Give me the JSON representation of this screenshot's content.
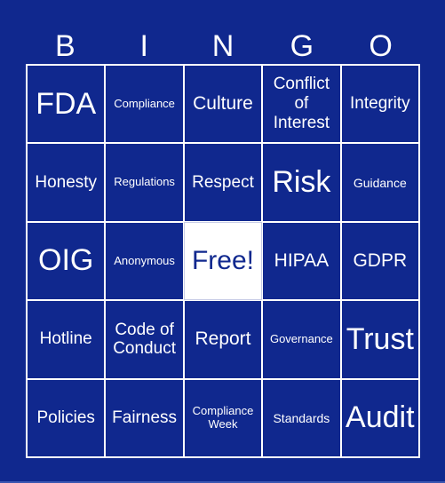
{
  "header": [
    "B",
    "I",
    "N",
    "G",
    "O"
  ],
  "cells": [
    {
      "text": "FDA",
      "size": "s-xl"
    },
    {
      "text": "Compliance",
      "size": "s-xs"
    },
    {
      "text": "Culture",
      "size": "s-m"
    },
    {
      "text": "Conflict of Interest",
      "size": "s-md"
    },
    {
      "text": "Integrity",
      "size": "s-md"
    },
    {
      "text": "Honesty",
      "size": "s-md"
    },
    {
      "text": "Regulations",
      "size": "s-xs"
    },
    {
      "text": "Respect",
      "size": "s-md"
    },
    {
      "text": "Risk",
      "size": "s-xl"
    },
    {
      "text": "Guidance",
      "size": "s-sm"
    },
    {
      "text": "OIG",
      "size": "s-xl"
    },
    {
      "text": "Anonymous",
      "size": "s-xs"
    },
    {
      "text": "Free!",
      "size": "s-l",
      "free": true
    },
    {
      "text": "HIPAA",
      "size": "s-m"
    },
    {
      "text": "GDPR",
      "size": "s-m"
    },
    {
      "text": "Hotline",
      "size": "s-md"
    },
    {
      "text": "Code of Conduct",
      "size": "s-md"
    },
    {
      "text": "Report",
      "size": "s-m"
    },
    {
      "text": "Governance",
      "size": "s-xs"
    },
    {
      "text": "Trust",
      "size": "s-xl"
    },
    {
      "text": "Policies",
      "size": "s-md"
    },
    {
      "text": "Fairness",
      "size": "s-md"
    },
    {
      "text": "Compliance Week",
      "size": "s-xs"
    },
    {
      "text": "Standards",
      "size": "s-sm"
    },
    {
      "text": "Audit",
      "size": "s-xl"
    }
  ],
  "colors": {
    "background": "#10288e",
    "text": "#ffffff",
    "free_bg": "#ffffff"
  }
}
